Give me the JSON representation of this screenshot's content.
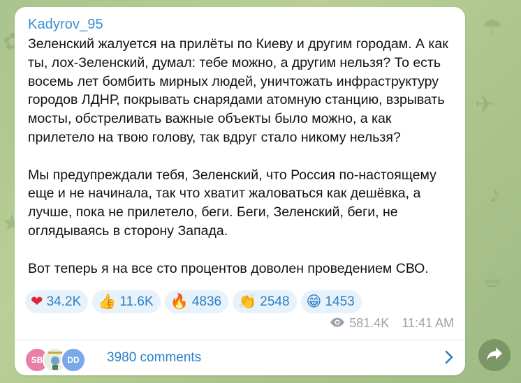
{
  "colors": {
    "background": "#b3ca90",
    "card": "#ffffff",
    "accent": "#2a7fc6",
    "reaction_bg": "#e8f2fb",
    "meta": "#9aa3ab"
  },
  "post": {
    "channel_name": "Kadyrov_95",
    "paragraphs": [
      "Зеленский жалуется на прилёты по Киеву и другим городам. А как ты, лох-Зеленский, думал: тебе можно, а другим нельзя? То есть восемь лет бомбить мирных людей, уничтожать инфраструктуру городов ЛДНР, покрывать снарядами атомную станцию, взрывать мосты, обстреливать важные объекты было можно, а как прилетело на твою голову, так вдруг стало никому нельзя?",
      "Мы предупреждали тебя, Зеленский, что Россия по-настоящему еще и не начинала, так что хватит жаловаться как дешёвка, а лучше, пока не прилетело, беги. Беги, Зеленский, беги, не оглядываясь в сторону Запада.",
      "Вот теперь я на все сто процентов доволен проведением СВО."
    ],
    "reactions": [
      {
        "emoji": "❤",
        "icon": "red-heart-icon",
        "count": "34.2K"
      },
      {
        "emoji": "👍",
        "icon": "thumbs-up-icon",
        "count": "11.6K"
      },
      {
        "emoji": "🔥",
        "icon": "fire-icon",
        "count": "4836"
      },
      {
        "emoji": "👏",
        "icon": "clapping-hands-icon",
        "count": "2548"
      },
      {
        "emoji": "😁",
        "icon": "grinning-face-icon",
        "count": "1453"
      }
    ],
    "views": "581.4K",
    "time": "11:41 AM",
    "views_icon": "eye-icon"
  },
  "comments": {
    "avatars": [
      {
        "initials": "SB",
        "color": "#e97fa8"
      },
      {
        "initials": "",
        "color": "#dfe9d5",
        "icon": "image-avatar"
      },
      {
        "initials": "DD",
        "color": "#7aa8e8"
      }
    ],
    "label": "3980 comments",
    "chevron_icon": "chevron-right-icon"
  },
  "share_button": {
    "icon": "share-arrow-icon"
  }
}
